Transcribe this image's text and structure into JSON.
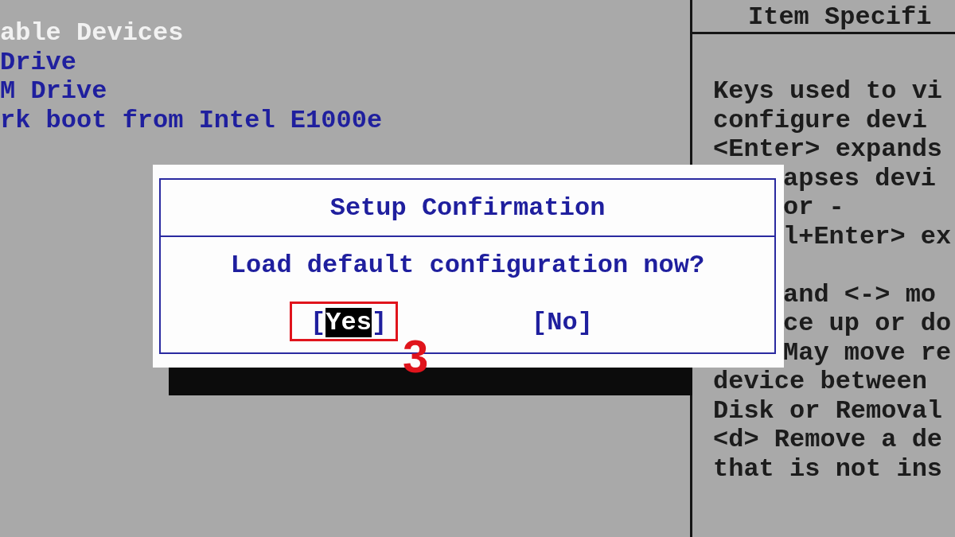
{
  "boot_list": {
    "items": [
      {
        "text": "able Devices",
        "kind": "header"
      },
      {
        "text": "Drive",
        "kind": "device"
      },
      {
        "text": "M Drive",
        "kind": "device"
      },
      {
        "text": "rk boot from Intel E1000e",
        "kind": "device"
      }
    ]
  },
  "help_panel": {
    "title": "Item Specifi",
    "lines": [
      {
        "text": "Keys used to vi",
        "kind": "full"
      },
      {
        "text": "configure devi",
        "kind": "full"
      },
      {
        "text": "<Enter> expands",
        "kind": "full"
      },
      {
        "text": "apses devi",
        "kind": "covered"
      },
      {
        "text": "or -",
        "kind": "covered"
      },
      {
        "text": "l+Enter> ex",
        "kind": "covered"
      },
      {
        "kind": "blank"
      },
      {
        "text": "and <-> mo",
        "kind": "covered"
      },
      {
        "text": "ce up or do",
        "kind": "covered"
      },
      {
        "text": "May move re",
        "kind": "covered"
      },
      {
        "text": "device between",
        "kind": "full"
      },
      {
        "text": "Disk or Removal",
        "kind": "full"
      },
      {
        "text": "<d> Remove a de",
        "kind": "full"
      },
      {
        "text": "that is not ins",
        "kind": "full"
      }
    ]
  },
  "dialog": {
    "title": "Setup Confirmation",
    "message": "Load default configuration now?",
    "buttons": [
      {
        "bracket_open": "[",
        "label": "Yes",
        "bracket_close": "]",
        "selected": true
      },
      {
        "bracket_open": "[",
        "label": "No",
        "bracket_close": "]",
        "selected": false
      }
    ]
  },
  "annotation": {
    "label": "3"
  }
}
